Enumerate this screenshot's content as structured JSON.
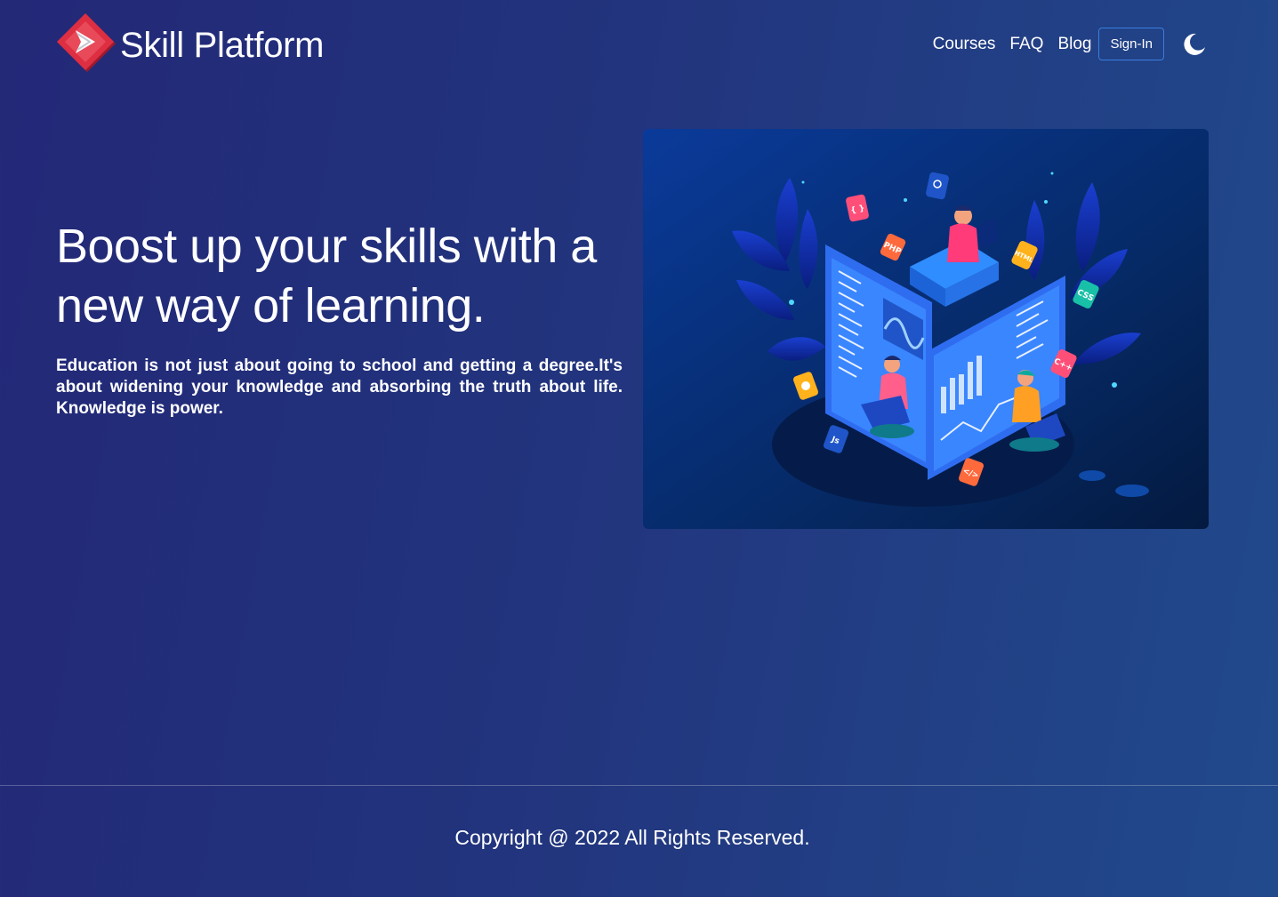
{
  "brand": {
    "name": "Skill Platform",
    "logo_icon": "play-logo-icon"
  },
  "nav": {
    "links": [
      "Courses",
      "FAQ",
      "Blog"
    ],
    "signin_label": "Sign-In",
    "theme_icon": "moon-icon"
  },
  "hero": {
    "title": "Boost up your skills with a new way of learning.",
    "description": "Education is not just about going to school and getting a degree.It's about widening your knowledge and absorbing the truth about life. Knowledge is power.",
    "illustration": {
      "icon": "online-learning-illustration",
      "badges": [
        "{ }",
        "PHP",
        "HTML",
        "CSS",
        "C++",
        "Js",
        "</>"
      ]
    }
  },
  "footer": {
    "copyright": "Copyright @ 2022 All Rights Reserved."
  },
  "colors": {
    "accent": "#3b7ddd",
    "logo_red": "#d42a3c",
    "background": "#22347d"
  }
}
